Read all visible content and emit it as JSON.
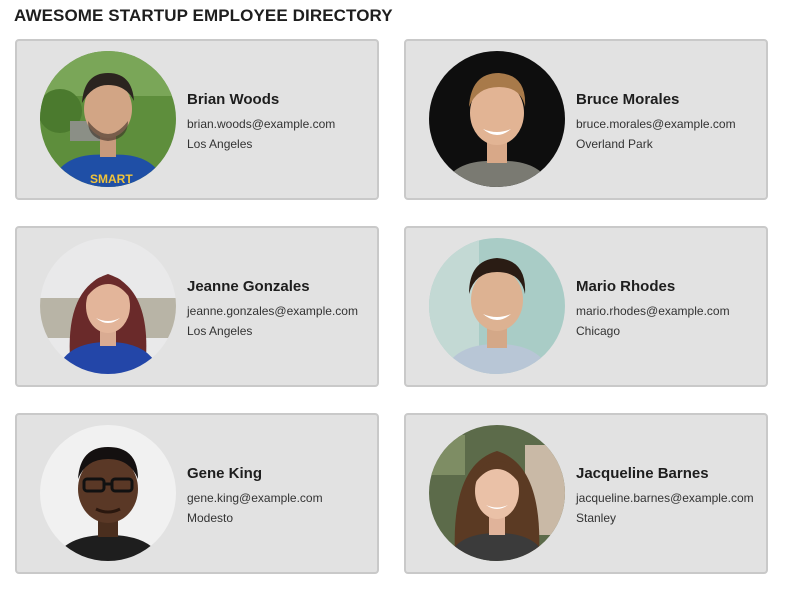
{
  "header": {
    "title": "AWESOME STARTUP EMPLOYEE DIRECTORY"
  },
  "employees": [
    {
      "name": "Brian Woods",
      "email": "brian.woods@example.com",
      "city": "Los Angeles"
    },
    {
      "name": "Bruce Morales",
      "email": "bruce.morales@example.com",
      "city": "Overland Park"
    },
    {
      "name": "Jeanne Gonzales",
      "email": "jeanne.gonzales@example.com",
      "city": "Los Angeles"
    },
    {
      "name": "Mario Rhodes",
      "email": "mario.rhodes@example.com",
      "city": "Chicago"
    },
    {
      "name": "Gene King",
      "email": "gene.king@example.com",
      "city": "Modesto"
    },
    {
      "name": "Jacqueline Barnes",
      "email": "jacqueline.barnes@example.com",
      "city": "Stanley"
    }
  ],
  "colors": {
    "card_background": "#e2e2e2",
    "card_border": "#c9c9c9"
  }
}
